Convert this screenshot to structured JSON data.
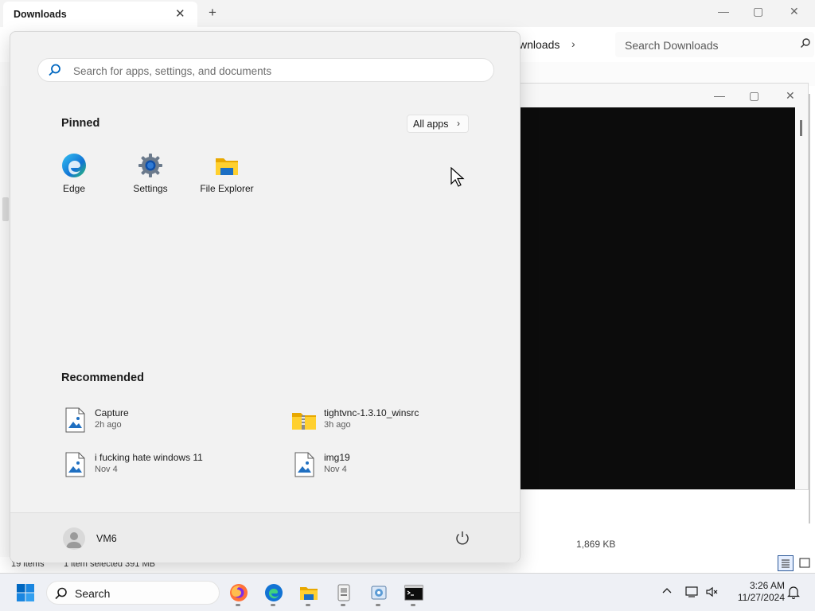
{
  "explorer": {
    "tab_title": "Downloads",
    "tab_close": "✕",
    "new_tab": "+",
    "minimize": "—",
    "maximize": "▢",
    "close": "✕",
    "breadcrumb_current": "wnloads",
    "breadcrumb_chevron": "›",
    "search_placeholder": "Search Downloads",
    "file_size": "1,869 KB",
    "status_items": "19 items",
    "status_selected": "1 item selected  391 MB"
  },
  "console": {
    "minimize": "—",
    "maximize": "▢",
    "close": "✕"
  },
  "start_menu": {
    "search_placeholder": "Search for apps, settings, and documents",
    "pinned_title": "Pinned",
    "all_apps_label": "All apps",
    "all_apps_chevron": "›",
    "pinned": [
      {
        "label": "Edge",
        "icon": "edge-icon"
      },
      {
        "label": "Settings",
        "icon": "settings-gear-icon"
      },
      {
        "label": "File Explorer",
        "icon": "folder-icon"
      }
    ],
    "recommended_title": "Recommended",
    "recommended": [
      {
        "name": "Capture",
        "time": "2h ago",
        "icon": "image-file-icon"
      },
      {
        "name": "tightvnc-1.3.10_winsrc",
        "time": "3h ago",
        "icon": "zip-folder-icon"
      },
      {
        "name": "i fucking hate windows 11",
        "time": "Nov 4",
        "icon": "image-file-icon"
      },
      {
        "name": "img19",
        "time": "Nov 4",
        "icon": "image-file-icon"
      }
    ],
    "user_name": "VM6"
  },
  "taskbar": {
    "search_label": "Search",
    "apps": [
      "firefox-icon",
      "edge-icon",
      "file-explorer-icon",
      "vnc-installer-icon",
      "setup-icon",
      "terminal-icon"
    ],
    "clock_time": "3:26 AM",
    "clock_date": "11/27/2024"
  },
  "colors": {
    "accent": "#0067c0",
    "start_bg": "#f2f2f2",
    "taskbar_bg": "#eef0f5",
    "console_bg": "#0c0c0c"
  }
}
